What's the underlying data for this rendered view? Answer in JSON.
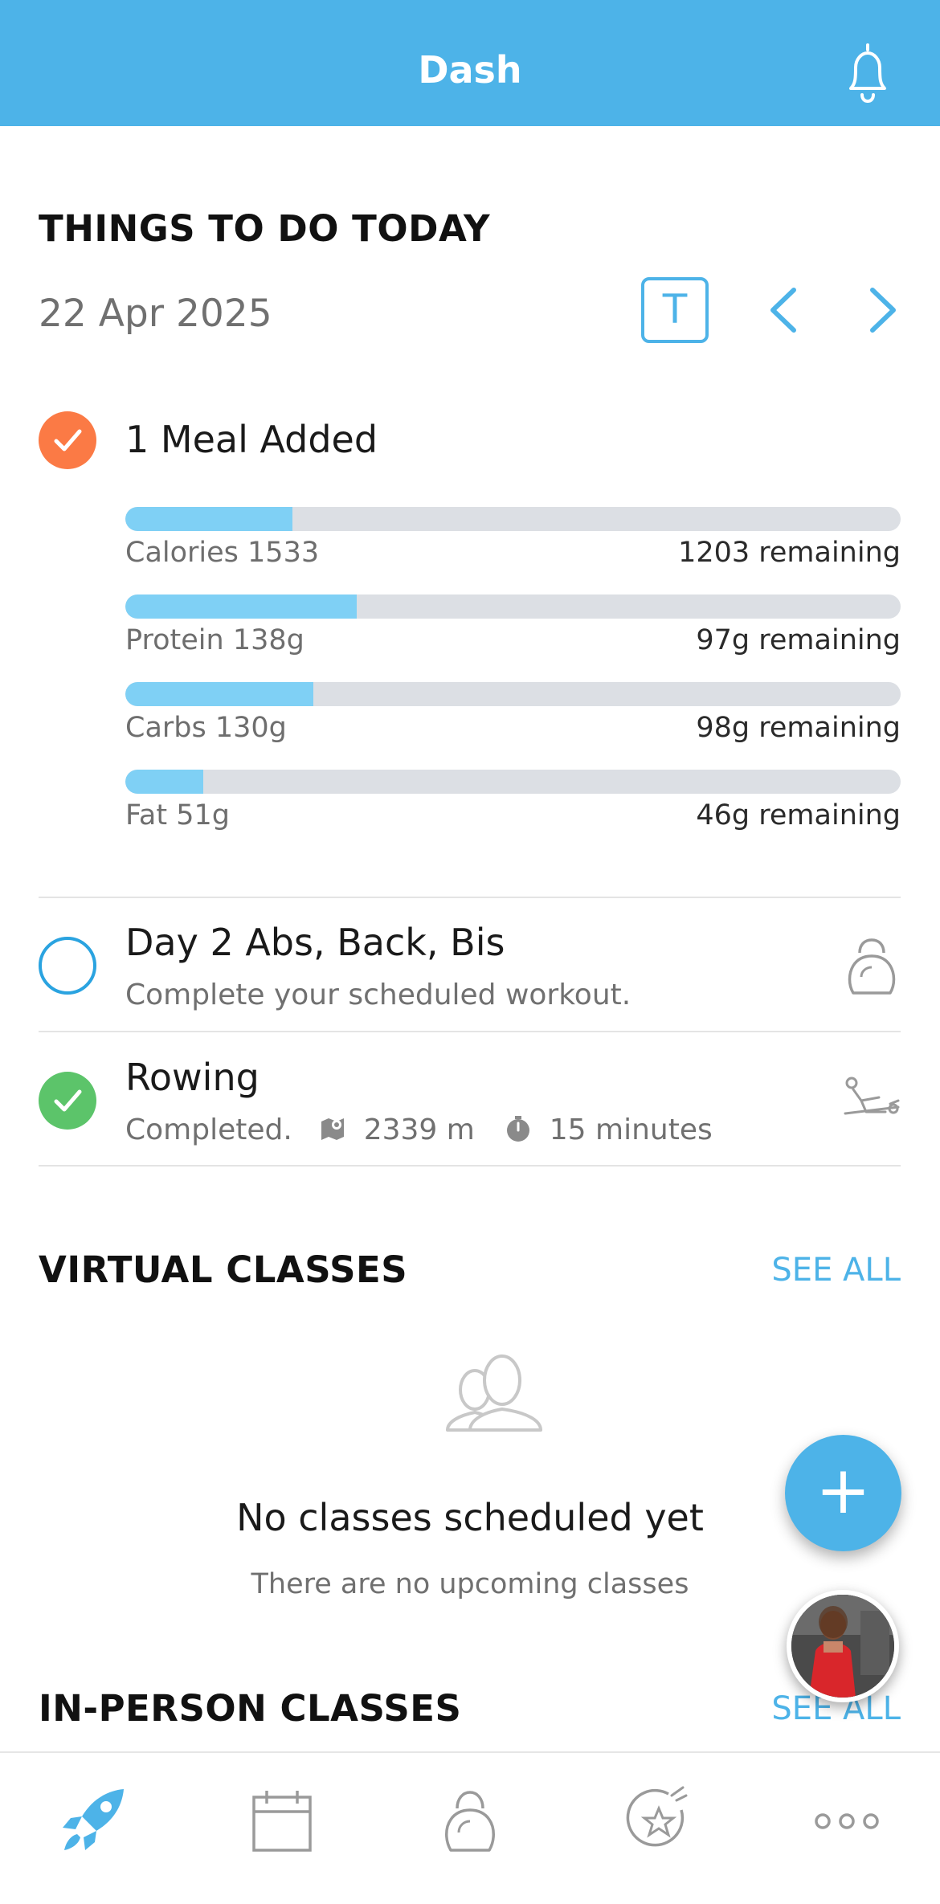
{
  "header": {
    "title": "Dash",
    "bell_icon": "bell-icon"
  },
  "today": {
    "section_title": "THINGS TO DO TODAY",
    "date": "22 Apr 2025",
    "today_button": "T"
  },
  "meal": {
    "label": "1 Meal Added",
    "status_color": "#fb7a45",
    "macros": [
      {
        "label": "Calories 1533",
        "remaining": "1203 remaining",
        "progress": 0.22
      },
      {
        "label": "Protein 138g",
        "remaining": "97g remaining",
        "progress": 0.3
      },
      {
        "label": "Carbs 130g",
        "remaining": "98g remaining",
        "progress": 0.24
      },
      {
        "label": "Fat 51g",
        "remaining": "46g remaining",
        "progress": 0.1
      }
    ]
  },
  "tasks": [
    {
      "title": "Day 2 Abs, Back, Bis",
      "subtitle": "Complete your scheduled workout.",
      "icon": "kettlebell-icon",
      "completed": false
    },
    {
      "title": "Rowing",
      "status": "Completed.",
      "distance": "2339 m",
      "duration": "15 minutes",
      "icon": "rowing-icon",
      "completed": true
    }
  ],
  "virtual": {
    "section_title": "VIRTUAL CLASSES",
    "see_all": "SEE ALL",
    "empty_title": "No classes scheduled yet",
    "empty_subtitle": "There are no upcoming classes"
  },
  "inperson": {
    "section_title": "IN-PERSON CLASSES",
    "see_all": "SEE ALL"
  },
  "fab": {
    "label": "+"
  },
  "tabbar": {
    "tabs": [
      "rocket-icon",
      "calendar-icon",
      "kettlebell-icon",
      "star-badge-icon",
      "more-icon"
    ],
    "active": 0
  },
  "colors": {
    "accent": "#4db3e8",
    "macro_fill": "#7fd0f5",
    "complete_green": "#5cc46a",
    "meal_orange": "#fb7a45"
  }
}
